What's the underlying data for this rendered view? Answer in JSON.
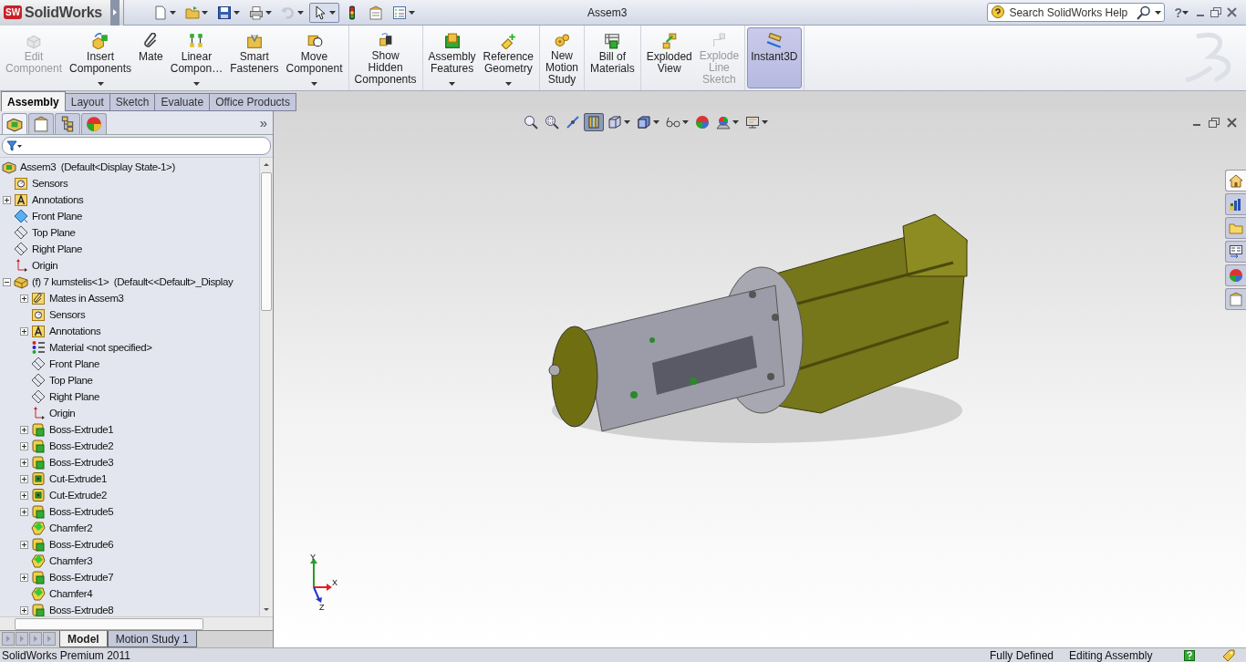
{
  "title_bar": {
    "logo_badge": "SW",
    "app_name": "SolidWorks",
    "title": "Assem3",
    "search": {
      "placeholder": "Search SolidWorks Help"
    },
    "help": "?"
  },
  "quick_access": [
    {
      "kind": "new",
      "caret": true,
      "selected": false,
      "disabled": false
    },
    {
      "kind": "open",
      "caret": true,
      "selected": false,
      "disabled": false
    },
    {
      "kind": "save",
      "caret": true,
      "selected": false,
      "disabled": false
    },
    {
      "kind": "print",
      "caret": true,
      "selected": false,
      "disabled": false
    },
    {
      "kind": "undo",
      "caret": true,
      "selected": false,
      "disabled": true
    },
    {
      "kind": "select",
      "caret": true,
      "selected": true,
      "disabled": false
    },
    {
      "kind": "rebuild",
      "caret": false,
      "selected": false,
      "disabled": false
    },
    {
      "kind": "file-properties",
      "caret": false,
      "selected": false,
      "disabled": false
    },
    {
      "kind": "options",
      "caret": true,
      "selected": false,
      "disabled": false
    }
  ],
  "ribbon": [
    [
      {
        "kind": "edit-component",
        "label": "Edit\nComponent",
        "caret": false,
        "disabled": true,
        "selected": false
      },
      {
        "kind": "insert-components",
        "label": "Insert\nComponents",
        "caret": true,
        "disabled": false,
        "selected": false
      },
      {
        "kind": "mate",
        "label": "Mate",
        "caret": false,
        "disabled": false,
        "selected": false
      },
      {
        "kind": "linear-pattern",
        "label": "Linear\nCompon…",
        "caret": true,
        "disabled": false,
        "selected": false
      },
      {
        "kind": "smart-fasteners",
        "label": "Smart\nFasteners",
        "caret": false,
        "disabled": false,
        "selected": false
      },
      {
        "kind": "move-component",
        "label": "Move\nComponent",
        "caret": true,
        "disabled": false,
        "selected": false
      }
    ],
    [
      {
        "kind": "show-hidden",
        "label": "Show\nHidden\nComponents",
        "caret": false,
        "disabled": false,
        "selected": false
      }
    ],
    [
      {
        "kind": "assembly-features",
        "label": "Assembly\nFeatures",
        "caret": true,
        "disabled": false,
        "selected": false
      },
      {
        "kind": "reference-geometry",
        "label": "Reference\nGeometry",
        "caret": true,
        "disabled": false,
        "selected": false
      }
    ],
    [
      {
        "kind": "motion-study",
        "label": "New\nMotion\nStudy",
        "caret": false,
        "disabled": false,
        "selected": false
      }
    ],
    [
      {
        "kind": "bill-of-materials",
        "label": "Bill of\nMaterials",
        "caret": false,
        "disabled": false,
        "selected": false
      }
    ],
    [
      {
        "kind": "exploded-view",
        "label": "Exploded\nView",
        "caret": false,
        "disabled": false,
        "selected": false
      },
      {
        "kind": "explode-line-sketch",
        "label": "Explode\nLine\nSketch",
        "caret": false,
        "disabled": true,
        "selected": false
      }
    ],
    [
      {
        "kind": "instant3d",
        "label": "Instant3D",
        "caret": false,
        "disabled": false,
        "selected": true
      }
    ]
  ],
  "tabs": [
    {
      "label": "Assembly",
      "selected": true
    },
    {
      "label": "Layout",
      "selected": false
    },
    {
      "label": "Sketch",
      "selected": false
    },
    {
      "label": "Evaluate",
      "selected": false
    },
    {
      "label": "Office Products",
      "selected": false
    }
  ],
  "panel_tabs": [
    {
      "kind": "feature-manager",
      "selected": true
    },
    {
      "kind": "property-manager",
      "selected": false
    },
    {
      "kind": "configuration-manager",
      "selected": false
    },
    {
      "kind": "display-manager",
      "selected": false
    }
  ],
  "panel_more": "»",
  "feature_tree": [
    {
      "kind": "assembly",
      "label": "Assem3  (Default<Display State-1>)",
      "children": [
        {
          "kind": "sensors",
          "label": "Sensors"
        },
        {
          "kind": "annotations",
          "label": "Annotations",
          "expanded": false
        },
        {
          "kind": "plane-active",
          "label": "Front Plane"
        },
        {
          "kind": "plane",
          "label": "Top Plane"
        },
        {
          "kind": "plane",
          "label": "Right Plane"
        },
        {
          "kind": "origin",
          "label": "Origin"
        },
        {
          "kind": "part",
          "label": "(f) 7 kumstelis<1>  (Default<<Default>_Display",
          "expanded": true,
          "children": [
            {
              "kind": "mates",
              "label": "Mates in Assem3",
              "expanded": false
            },
            {
              "kind": "sensors",
              "label": "Sensors"
            },
            {
              "kind": "annotations",
              "label": "Annotations",
              "expanded": false
            },
            {
              "kind": "material",
              "label": "Material <not specified>"
            },
            {
              "kind": "plane",
              "label": "Front Plane"
            },
            {
              "kind": "plane",
              "label": "Top Plane"
            },
            {
              "kind": "plane",
              "label": "Right Plane"
            },
            {
              "kind": "origin",
              "label": "Origin"
            },
            {
              "kind": "boss",
              "label": "Boss-Extrude1",
              "expanded": false
            },
            {
              "kind": "boss",
              "label": "Boss-Extrude2",
              "expanded": false
            },
            {
              "kind": "boss",
              "label": "Boss-Extrude3",
              "expanded": false
            },
            {
              "kind": "cut",
              "label": "Cut-Extrude1",
              "expanded": false
            },
            {
              "kind": "cut",
              "label": "Cut-Extrude2",
              "expanded": false
            },
            {
              "kind": "boss",
              "label": "Boss-Extrude5",
              "expanded": false
            },
            {
              "kind": "chamfer",
              "label": "Chamfer2"
            },
            {
              "kind": "boss",
              "label": "Boss-Extrude6",
              "expanded": false
            },
            {
              "kind": "chamfer",
              "label": "Chamfer3"
            },
            {
              "kind": "boss",
              "label": "Boss-Extrude7",
              "expanded": false
            },
            {
              "kind": "chamfer",
              "label": "Chamfer4"
            },
            {
              "kind": "boss",
              "label": "Boss-Extrude8",
              "expanded": false
            }
          ]
        }
      ]
    }
  ],
  "bottom_tabs": [
    {
      "label": "Model",
      "selected": true
    },
    {
      "label": "Motion Study 1",
      "selected": false
    }
  ],
  "view_toolbar": [
    {
      "kind": "zoom-fit",
      "caret": false,
      "selected": false
    },
    {
      "kind": "zoom-area",
      "caret": false,
      "selected": false
    },
    {
      "kind": "previous-view",
      "caret": false,
      "selected": false
    },
    {
      "kind": "section-view",
      "caret": false,
      "selected": true
    },
    {
      "kind": "view-orientation",
      "caret": true,
      "selected": false
    },
    {
      "kind": "display-style",
      "caret": true,
      "selected": false
    },
    {
      "kind": "hide-show",
      "caret": true,
      "selected": false
    },
    {
      "kind": "appearance",
      "caret": false,
      "selected": false
    },
    {
      "kind": "scene",
      "caret": true,
      "selected": false
    },
    {
      "kind": "view-settings",
      "caret": true,
      "selected": false
    }
  ],
  "task_pane": [
    {
      "kind": "home",
      "selected": true
    },
    {
      "kind": "design-library",
      "selected": false
    },
    {
      "kind": "file-explorer",
      "selected": false
    },
    {
      "kind": "view-palette",
      "selected": false
    },
    {
      "kind": "appearances",
      "selected": false
    },
    {
      "kind": "custom-properties",
      "selected": false
    }
  ],
  "triad": {
    "x": "X",
    "y": "Y",
    "z": "Z"
  },
  "status_bar": {
    "product": "SolidWorks Premium 2011",
    "state": "Fully Defined",
    "mode": "Editing Assembly"
  }
}
